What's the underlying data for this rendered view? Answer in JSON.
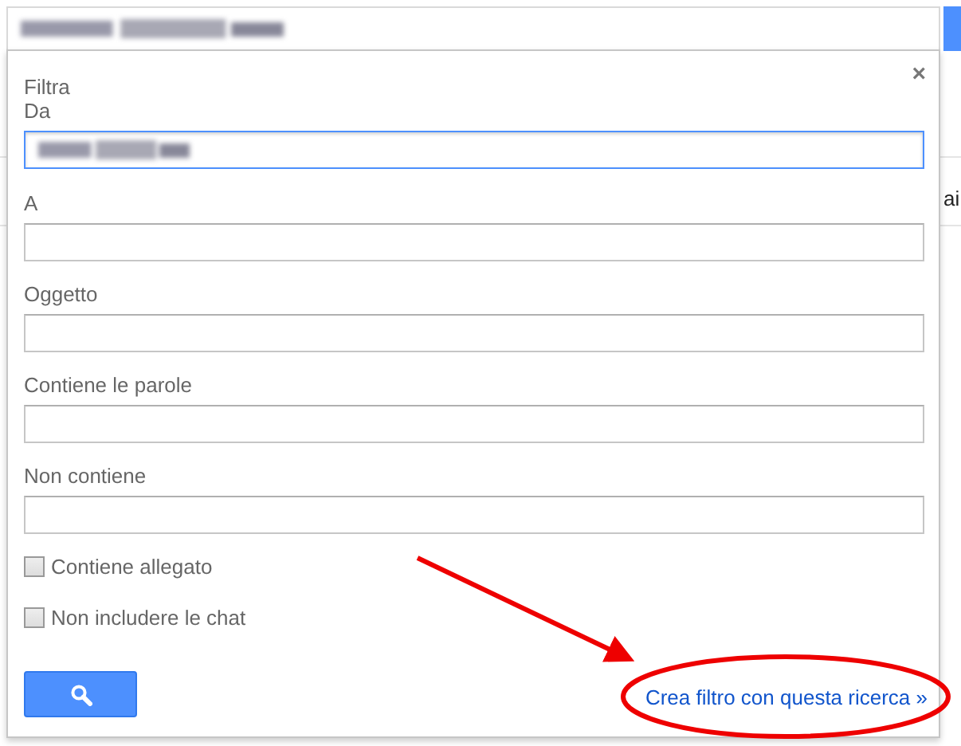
{
  "search_bar": {
    "redacted": true
  },
  "background_text": "ai",
  "filter_panel": {
    "title": "Filtra",
    "close": "×",
    "fields": [
      {
        "label": "Da",
        "focused": true,
        "redacted": true
      },
      {
        "label": "A",
        "focused": false,
        "redacted": false
      },
      {
        "label": "Oggetto",
        "focused": false,
        "redacted": false
      },
      {
        "label": "Contiene le parole",
        "focused": false,
        "redacted": false
      },
      {
        "label": "Non contiene",
        "focused": false,
        "redacted": false
      }
    ],
    "checkboxes": [
      {
        "label": "Contiene allegato",
        "checked": false
      },
      {
        "label": "Non includere le chat",
        "checked": false
      }
    ],
    "create_filter_link": "Crea filtro con questa ricerca »"
  }
}
